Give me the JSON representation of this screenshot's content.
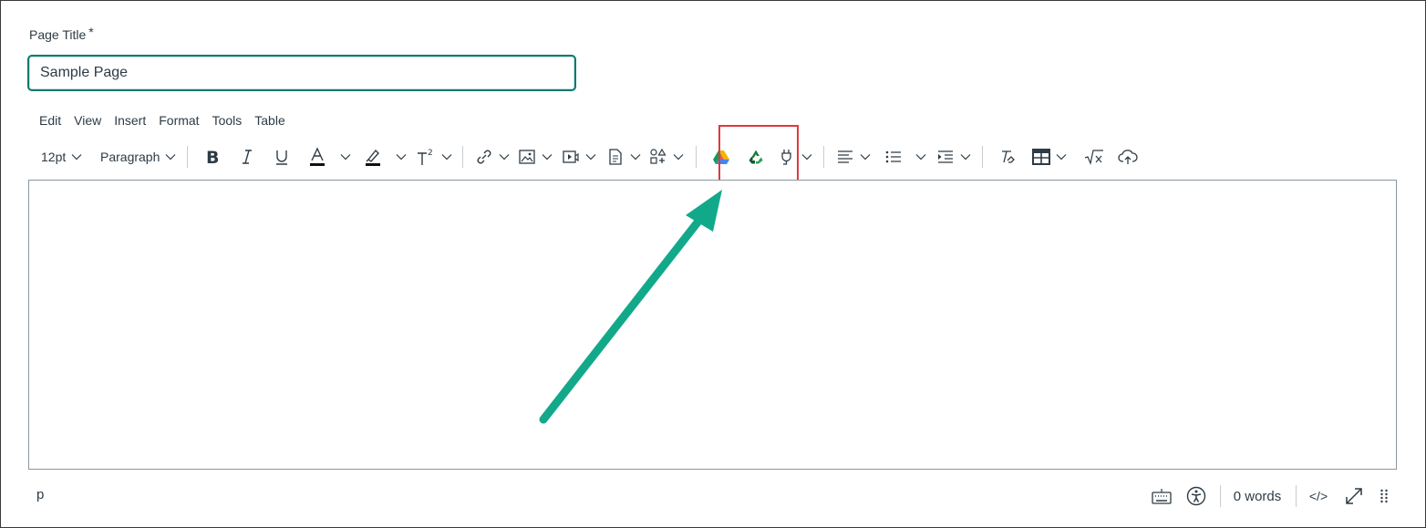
{
  "form": {
    "title_label": "Page Title",
    "required_mark": "*",
    "title_value": "Sample Page"
  },
  "menubar": {
    "items": [
      "Edit",
      "View",
      "Insert",
      "Format",
      "Tools",
      "Table"
    ]
  },
  "toolbar": {
    "font_size": "12pt",
    "block_format": "Paragraph",
    "icons": [
      "bold-icon",
      "italic-icon",
      "underline-icon",
      "text-color-icon",
      "highlight-color-icon",
      "superscript-icon",
      "link-icon",
      "image-icon",
      "media-icon",
      "document-icon",
      "apps-icon",
      "google-drive-icon",
      "recycle-icon",
      "plugin-icon",
      "align-icon",
      "bullet-list-icon",
      "indent-icon",
      "clear-formatting-icon",
      "table-icon",
      "equation-icon",
      "cloud-upload-icon"
    ],
    "colors": {
      "accent": "#0b7a6e",
      "highlight_box": "#e0393e",
      "arrow": "#12a98a"
    }
  },
  "statusbar": {
    "path": "p",
    "word_count": "0 words",
    "html_toggle": "</>"
  }
}
